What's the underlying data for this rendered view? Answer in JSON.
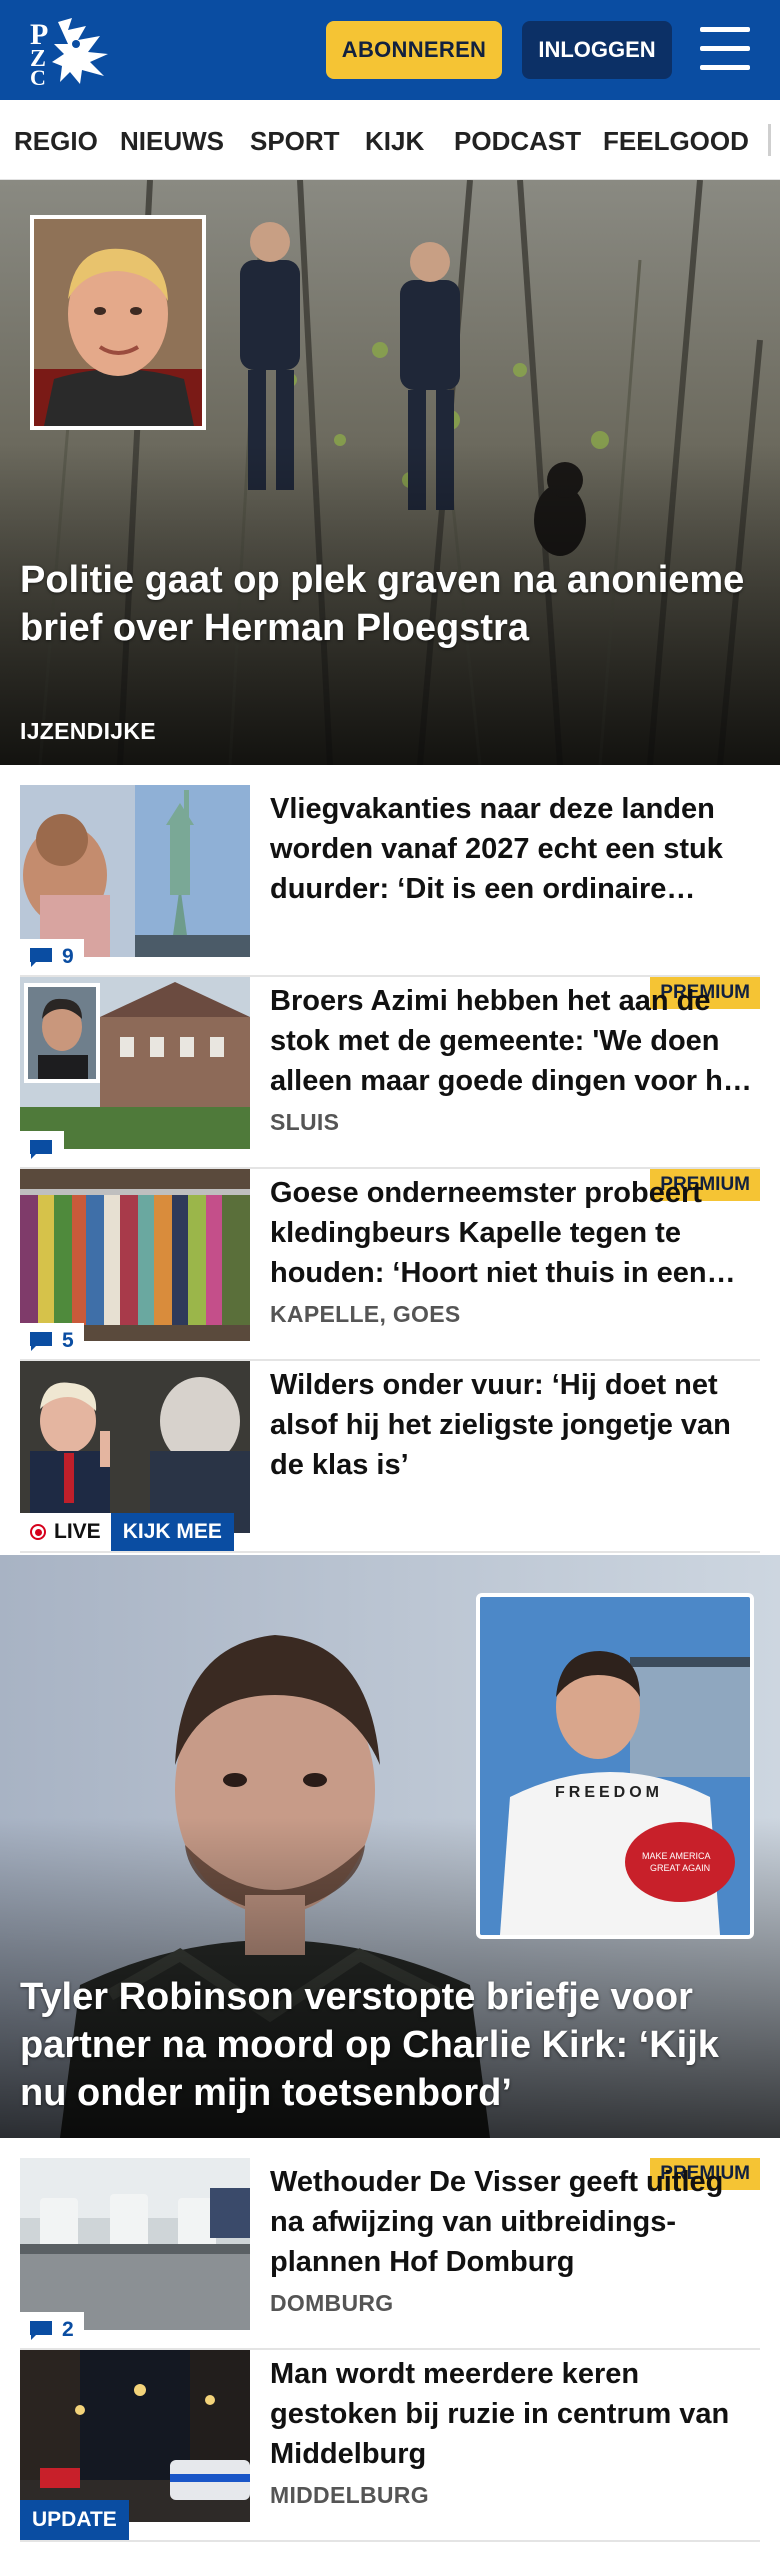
{
  "header": {
    "subscribe_label": "ABONNEREN",
    "login_label": "INLOGGEN",
    "brand_color": "#0a4da2",
    "accent_color": "#f5c434"
  },
  "nav": {
    "items": [
      {
        "label": "REGIO"
      },
      {
        "label": "NIEUWS"
      },
      {
        "label": "SPORT"
      },
      {
        "label": "KIJK"
      },
      {
        "label": "PODCAST"
      },
      {
        "label": "FEELGOOD"
      }
    ]
  },
  "hero": {
    "title": "Politie gaat op plek graven na anonieme brief over Herman Ploegstra",
    "place": "IJZENDIJKE"
  },
  "articles": [
    {
      "title": "Vliegvakanties naar deze landen worden vanaf 2027 echt een stuk duurder: ‘Dit is een ordinaire belastingverhoging’",
      "comments": "9"
    },
    {
      "title": "Broers Azimi hebben het aan de stok met de gemeente: 'We doen alleen maar goede dingen voor het dorp'",
      "place": "SLUIS",
      "badge": "PREMIUM"
    },
    {
      "title": "Goese onderneemster probeert kledingbeurs Kapelle tegen te houden: ‘Hoort niet thuis in een kerk’",
      "place": "KAPELLE, GOES",
      "badge": "PREMIUM",
      "comments": "5"
    },
    {
      "title": "Wilders onder vuur: ‘Hij doet net alsof hij het zieligste jongetje van de klas is’",
      "live_label": "LIVE",
      "watch_label": "KIJK MEE"
    }
  ],
  "hero2": {
    "title": "Tyler Robinson verstopte briefje voor partner na moord op Charlie Kirk: ‘Kijk nu onder mijn toetsenbord’"
  },
  "articles2": [
    {
      "title": "Wethouder De Visser geeft uitleg na afwijzing van uitbreidings-plannen Hof Domburg",
      "place": "DOMBURG",
      "badge": "PREMIUM",
      "comments": "2"
    },
    {
      "title": "Man wordt meerdere keren gestoken bij ruzie in centrum van Middelburg",
      "place": "MIDDELBURG",
      "update_label": "UPDATE"
    }
  ]
}
